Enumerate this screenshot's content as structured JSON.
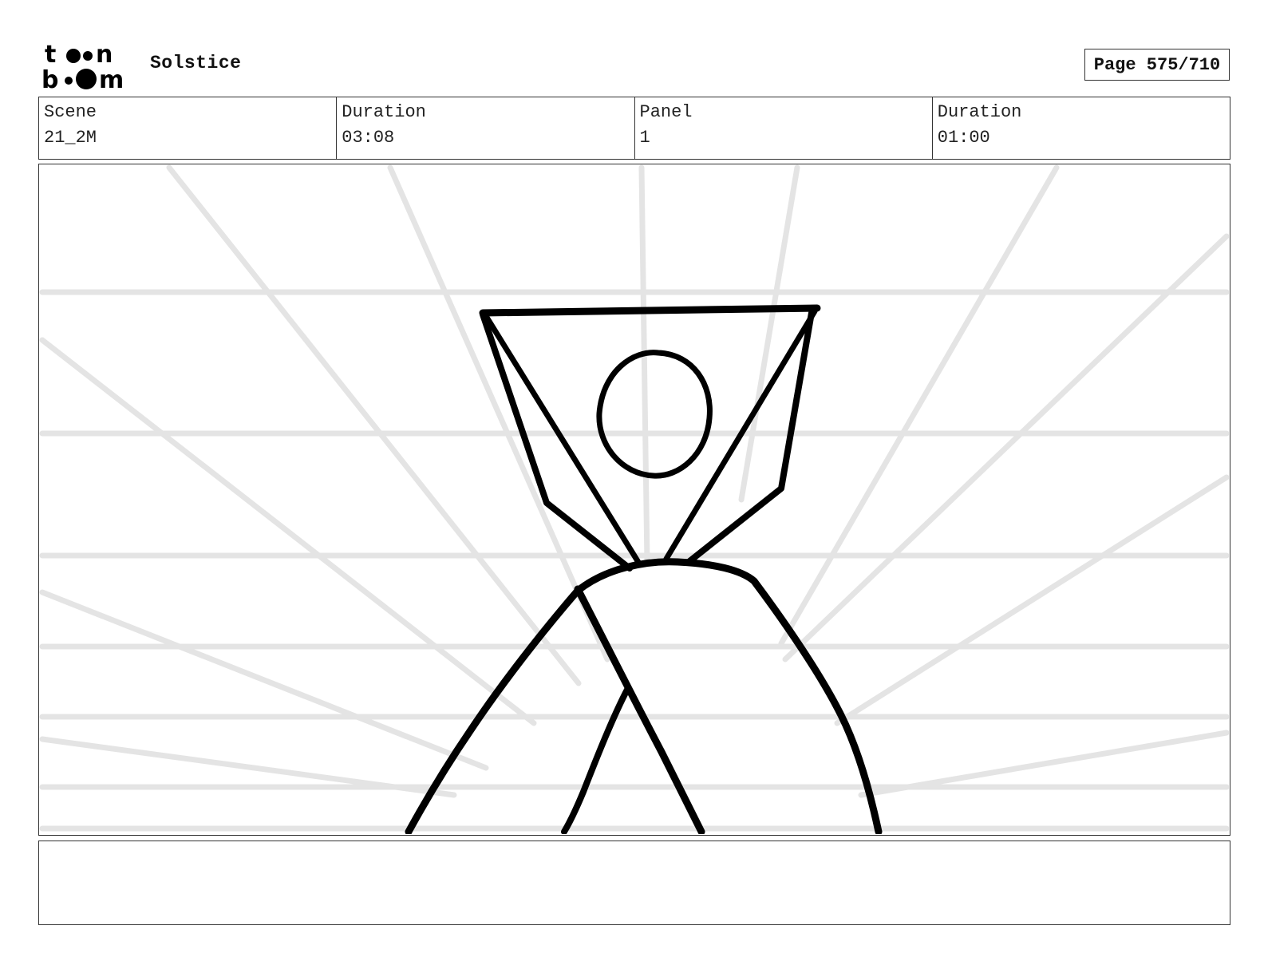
{
  "header": {
    "logo_text": "toon boom",
    "project_title": "Solstice",
    "page_label": "Page 575/710"
  },
  "info": [
    {
      "label": "Scene",
      "value": "21_2M"
    },
    {
      "label": "Duration",
      "value": "03:08"
    },
    {
      "label": "Panel",
      "value": "1"
    },
    {
      "label": "Duration",
      "value": "01:00"
    }
  ],
  "panel": {
    "sketch": "figure-with-raised-arms",
    "guide_color": "#e4e4e4",
    "ink_color": "#000000"
  },
  "notes": {
    "text": ""
  },
  "colors": {
    "border": "#333333",
    "background": "#ffffff"
  }
}
